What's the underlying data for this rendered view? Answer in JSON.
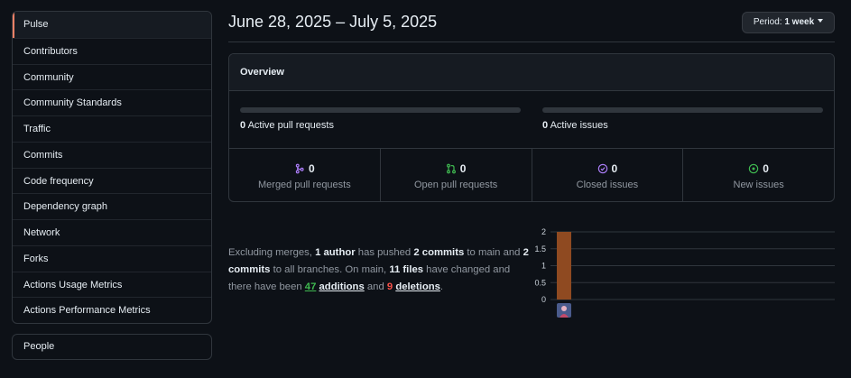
{
  "sidebar": {
    "items": [
      {
        "label": "Pulse"
      },
      {
        "label": "Contributors"
      },
      {
        "label": "Community"
      },
      {
        "label": "Community Standards"
      },
      {
        "label": "Traffic"
      },
      {
        "label": "Commits"
      },
      {
        "label": "Code frequency"
      },
      {
        "label": "Dependency graph"
      },
      {
        "label": "Network"
      },
      {
        "label": "Forks"
      },
      {
        "label": "Actions Usage Metrics"
      },
      {
        "label": "Actions Performance Metrics"
      }
    ],
    "secondary": {
      "label": "People"
    }
  },
  "header": {
    "date_range": "June 28, 2025 – July 5, 2025",
    "period_prefix": "Period:",
    "period_value": "1 week"
  },
  "overview": {
    "title": "Overview",
    "active_prs_count": "0",
    "active_prs_label": "Active pull requests",
    "active_issues_count": "0",
    "active_issues_label": "Active issues",
    "stats": [
      {
        "icon": "merge-icon",
        "count": "0",
        "label": "Merged pull requests",
        "color": "#ab7df8"
      },
      {
        "icon": "pull-request-icon",
        "count": "0",
        "label": "Open pull requests",
        "color": "#3fb950"
      },
      {
        "icon": "issue-closed-icon",
        "count": "0",
        "label": "Closed issues",
        "color": "#ab7df8"
      },
      {
        "icon": "issue-opened-icon",
        "count": "0",
        "label": "New issues",
        "color": "#3fb950"
      }
    ]
  },
  "summary": {
    "t1": "Excluding merges, ",
    "authors": "1 author",
    "t2": " has pushed ",
    "commits_main": "2 commits",
    "t3": " to main and ",
    "commits_all": "2 commits",
    "t4": " to all branches. On main, ",
    "files": "11 files",
    "t5": " have changed and there have been ",
    "additions_num": "47",
    "additions_word": "additions",
    "t6": " and ",
    "deletions_num": "9",
    "deletions_word": "deletions",
    "t7": "."
  },
  "chart_data": {
    "type": "bar",
    "categories": [
      "author-avatar"
    ],
    "values": [
      2
    ],
    "ylim": [
      0,
      2
    ],
    "yticks": [
      "0",
      "0.5",
      "1",
      "1.5",
      "2"
    ],
    "bar_color": "#8f4a21",
    "grid": true
  }
}
